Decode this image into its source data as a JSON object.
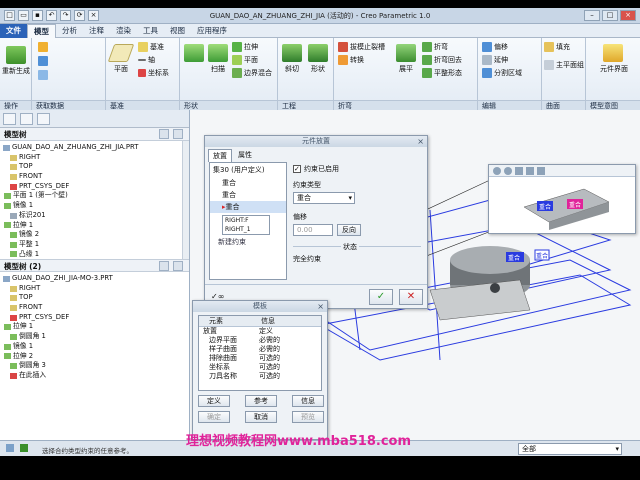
{
  "window": {
    "title": "GUAN_DAO_AN_ZHUANG_ZHI_JIA (活动的) - Creo Parametric 1.0"
  },
  "menu": {
    "tabs": [
      "文件",
      "模型",
      "分析",
      "注释",
      "渲染",
      "工具",
      "视图",
      "应用程序"
    ],
    "active": "模型"
  },
  "ribbon": {
    "groups": [
      {
        "label": "操作",
        "items": [
          "重新生成"
        ]
      },
      {
        "label": "获取数据",
        "items": [
          "用户定义特征",
          "复制几何",
          "收缩包络"
        ]
      },
      {
        "label": "基准",
        "items": [
          "平面",
          "基准",
          "轴",
          "坐标系",
          "草绘",
          "点"
        ]
      },
      {
        "label": "形状",
        "items": [
          "拉伸",
          "旋转",
          "扫描",
          "扫描混合",
          "平面",
          "边界混合"
        ]
      },
      {
        "label": "工程",
        "items": [
          "筋",
          "壳",
          "拔模",
          "孔",
          "倒圆角",
          "倒角"
        ]
      },
      {
        "label": "编辑",
        "items": [
          "拔模止裂槽",
          "转换",
          "折弯",
          "展平",
          "折弯回去",
          "平整形态",
          "偏移",
          "延伸",
          "分割区域",
          "填充"
        ]
      },
      {
        "label": "曲面",
        "items": [
          "填充",
          "样式",
          "自由式"
        ]
      },
      {
        "label": "模型意图",
        "items": [
          "元件界面"
        ]
      }
    ],
    "extra_labels": [
      "斜切",
      "形状",
      "展平",
      "折弯",
      "扭曲",
      "主平面组"
    ]
  },
  "model_tree_1": {
    "header": "模型树",
    "rows": [
      "GUAN_DAO_AN_ZHUANG_ZHI_JIA.PRT",
      "RIGHT",
      "TOP",
      "FRONT",
      "PRT_CSYS_DEF",
      "平面 1 (第一个壁)",
      "镜像 1",
      "标识201",
      "拉伸 1",
      "镜像 2",
      "平整 1",
      "凸缘 1"
    ]
  },
  "model_tree_2": {
    "header": "模型树 (2)",
    "rows": [
      "GUAN_DAO_ZHI_JIA-MO-3.PRT",
      "RIGHT",
      "TOP",
      "FRONT",
      "PRT_CSYS_DEF",
      "拉伸 1",
      "倒圆角 1",
      "镜像 1",
      "拉伸 2",
      "倒圆角 3",
      "在此插入"
    ]
  },
  "placement_dialog": {
    "title": "元件放置",
    "tabs": [
      "放置",
      "属性"
    ],
    "set_label": "集30 (用户定义)",
    "set_items": [
      "重合",
      "重合"
    ],
    "selected_constraint": "重合",
    "refs": [
      "RIGHT:F",
      "RIGHT_1"
    ],
    "new_constraint": "新建约束",
    "enabled_label": "约束已启用",
    "constraint_type_label": "约束类型",
    "constraint_type_value": "重合",
    "offset_label": "偏移",
    "offset_value": "0.00",
    "flip_label": "反向",
    "status_label": "状态",
    "status_value": "完全约束"
  },
  "template_dialog": {
    "title": "模板",
    "col1": "元素",
    "col2": "信息",
    "rows": [
      [
        "放置",
        "定义"
      ],
      [
        "边界平面",
        "必需的"
      ],
      [
        "样子曲面",
        "必需的"
      ],
      [
        "排除曲面",
        "可选的"
      ],
      [
        "坐标系",
        "可选的"
      ],
      [
        "刀具名称",
        "可选的"
      ]
    ],
    "buttons": [
      "定义",
      "参考",
      "信息",
      "确定",
      "取消",
      "预览"
    ]
  },
  "mini_view": {
    "labels": [
      "重合",
      "重合"
    ]
  },
  "viewport": {
    "labels": [
      "重合",
      "重合"
    ]
  },
  "status": {
    "message": "选择合约类型约束的任意参考。",
    "filter_value": "全部"
  },
  "watermark": "理想视频教程网www.mba518.com",
  "colors": {
    "accent": "#2b63b8",
    "wire_blue": "#2a3be0",
    "tag_magenta": "#e0239a"
  }
}
